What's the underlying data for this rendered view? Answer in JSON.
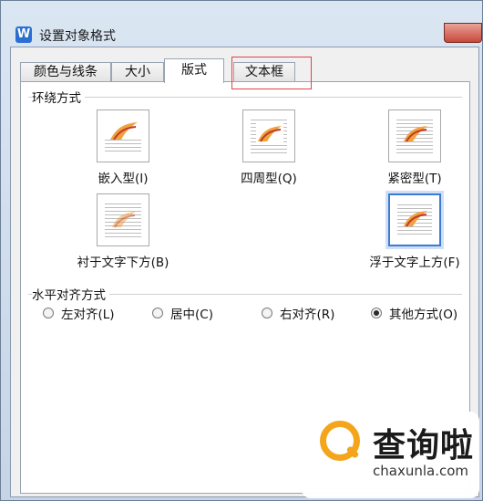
{
  "window": {
    "title": "设置对象格式",
    "app_icon_letter": "W"
  },
  "tabs": [
    {
      "label": "颜色与线条",
      "active": false
    },
    {
      "label": "大小",
      "active": false
    },
    {
      "label": "版式",
      "active": true
    },
    {
      "label": "文本框",
      "active": false
    }
  ],
  "wrap_section": {
    "title": "环绕方式",
    "options": [
      {
        "label": "嵌入型(I)",
        "selected": false
      },
      {
        "label": "四周型(Q)",
        "selected": false
      },
      {
        "label": "紧密型(T)",
        "selected": false
      },
      {
        "label": "衬于文字下方(B)",
        "selected": false
      },
      {
        "label": "浮于文字上方(F)",
        "selected": true
      }
    ]
  },
  "align_section": {
    "title": "水平对齐方式",
    "options": [
      {
        "label": "左对齐(L)",
        "checked": false
      },
      {
        "label": "居中(C)",
        "checked": false
      },
      {
        "label": "右对齐(R)",
        "checked": false
      },
      {
        "label": "其他方式(O)",
        "checked": true
      }
    ]
  },
  "watermark": {
    "text": "查询啦",
    "url": "chaxunla.com"
  },
  "colors": {
    "highlight": "#e0454b",
    "selected_border": "#3b7bd4"
  }
}
